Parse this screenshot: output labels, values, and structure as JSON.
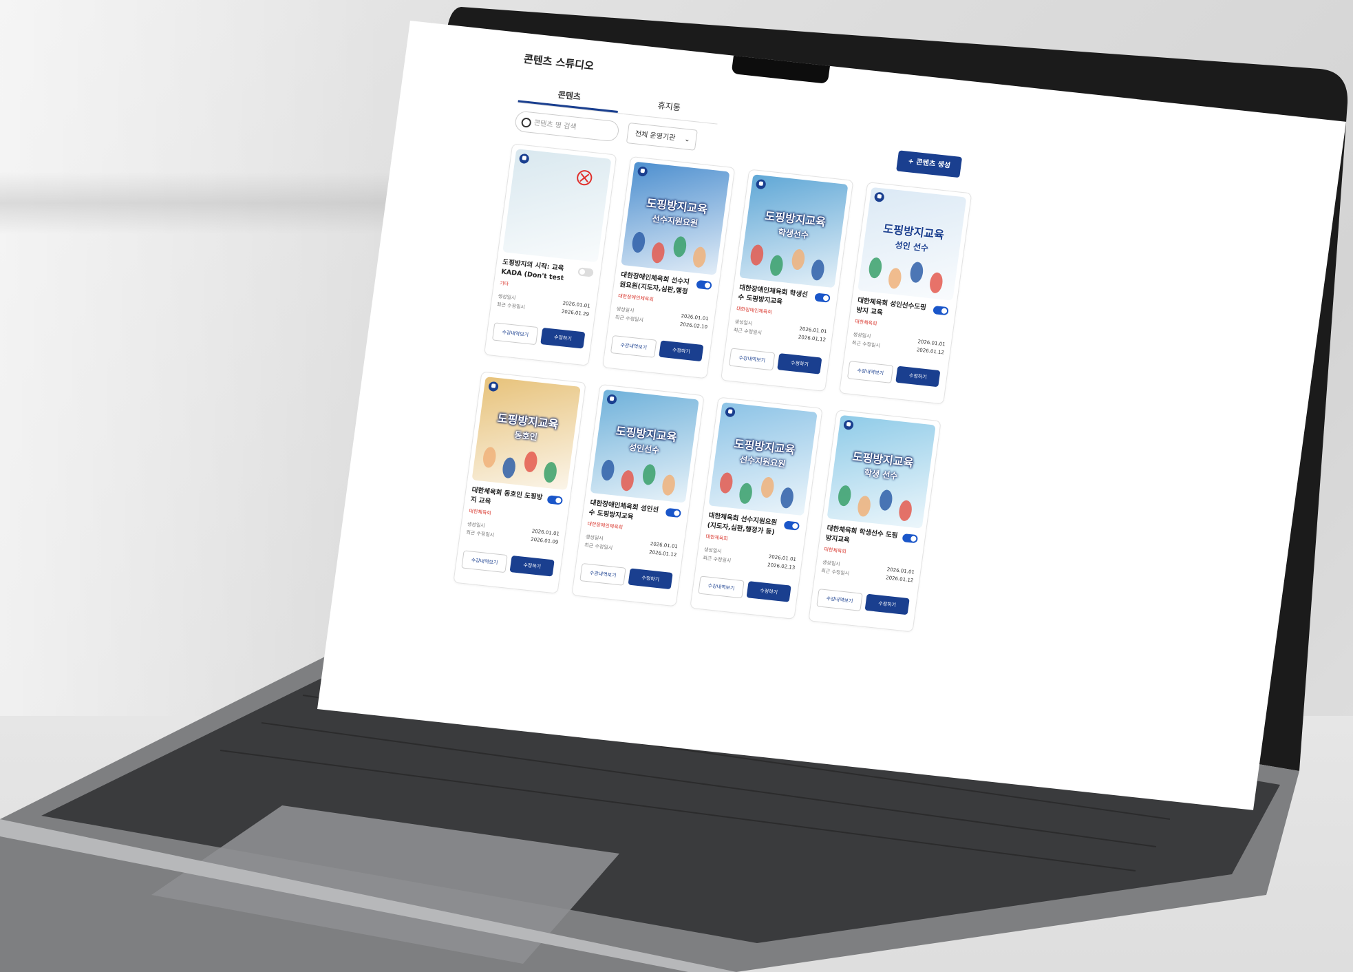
{
  "studio_title": "콘텐츠 스튜디오",
  "tabs": [
    {
      "label": "콘텐츠"
    },
    {
      "label": "휴지통"
    }
  ],
  "search": {
    "placeholder": "콘텐츠 명 검색"
  },
  "filter": {
    "label": "전체 운영기관"
  },
  "create_button": "+ 콘텐츠 생성",
  "card_labels": {
    "created": "생성일시",
    "updated": "최근 수정일시",
    "history_button": "수강내역보기",
    "edit_button": "수정하기"
  },
  "cards": [
    {
      "title": "도핑방지의 시작: 교육 KADA (Don't test on...",
      "org": "기타",
      "created": "2026.01.01",
      "updated": "2026.01.29",
      "toggle": false,
      "thumb_line1": "",
      "thumb_line2": "",
      "thumb_bg": "#d9e8ef"
    },
    {
      "title": "대한장애인체육회 선수지원요원(지도자,심판,행정가...",
      "org": "대한장애인체육회",
      "created": "2026.01.01",
      "updated": "2026.02.10",
      "toggle": true,
      "thumb_line1": "도핑방지교육",
      "thumb_line2": "선수지원요원",
      "thumb_bg": "#4d8fcf"
    },
    {
      "title": "대한장애인체육회 학생선수 도핑방지교육",
      "org": "대한장애인체육회",
      "created": "2026.01.01",
      "updated": "2026.01.12",
      "toggle": true,
      "thumb_line1": "도핑방지교육",
      "thumb_line2": "학생선수",
      "thumb_bg": "#5fa7d6"
    },
    {
      "title": "대한체육회 성인선수도핑방지 교육",
      "org": "대한체육회",
      "created": "2026.01.01",
      "updated": "2026.01.12",
      "toggle": true,
      "thumb_line1": "도핑방지교육",
      "thumb_line2": "성인 선수",
      "thumb_bg": "#dbe9f5"
    },
    {
      "title": "대한체육회 동호인 도핑방지 교육",
      "org": "대한체육회",
      "created": "2026.01.01",
      "updated": "2026.01.09",
      "toggle": true,
      "thumb_line1": "도핑방지교육",
      "thumb_line2": "동호인",
      "thumb_bg": "#e7c27a"
    },
    {
      "title": "대한장애인체육회 성인선수 도핑방지교육",
      "org": "대한장애인체육회",
      "created": "2026.01.01",
      "updated": "2026.01.12",
      "toggle": true,
      "thumb_line1": "도핑방지교육",
      "thumb_line2": "성인선수",
      "thumb_bg": "#6fb1da"
    },
    {
      "title": "대한체육회 선수지원요원 (지도자,심판,행정가 등) ...",
      "org": "대한체육회",
      "created": "2026.01.01",
      "updated": "2026.02.13",
      "toggle": true,
      "thumb_line1": "도핑방지교육",
      "thumb_line2": "선수지원요원",
      "thumb_bg": "#8cc3e6"
    },
    {
      "title": "대한체육회 학생선수 도핑방지교육",
      "org": "대한체육회",
      "created": "2026.01.01",
      "updated": "2026.01.12",
      "toggle": true,
      "thumb_line1": "도핑방지교육",
      "thumb_line2": "학생 선수",
      "thumb_bg": "#8fcbe8"
    }
  ],
  "colors": {
    "accent": "#1a3f8f",
    "toggle_on": "#1a56c9",
    "org_text": "#d9372e"
  }
}
